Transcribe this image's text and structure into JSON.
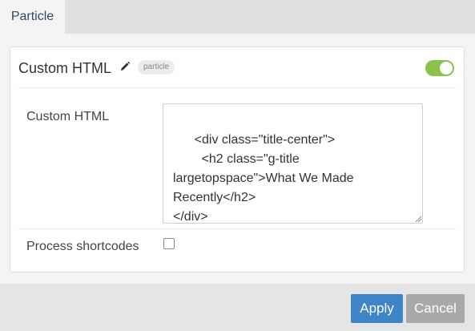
{
  "tabs": [
    {
      "label": "Particle",
      "active": true
    }
  ],
  "header": {
    "title": "Custom HTML",
    "badge": "particle",
    "enabled": true
  },
  "fields": {
    "custom_html_label": "Custom HTML",
    "custom_html_value": "<div class=\"title-center\">\n        <h2 class=\"g-title largetopspace\">What We Made Recently</h2>\n</div>",
    "process_shortcodes_label": "Process shortcodes",
    "process_shortcodes_checked": false
  },
  "footer": {
    "apply_label": "Apply",
    "cancel_label": "Cancel"
  },
  "colors": {
    "toggle_on": "#8bc34a",
    "apply": "#3d85c6",
    "cancel": "#a9a9a9",
    "tab_text": "#2d4a6b"
  },
  "icons": {
    "edit": "pencil-icon",
    "resize": "resize-grip-icon"
  }
}
